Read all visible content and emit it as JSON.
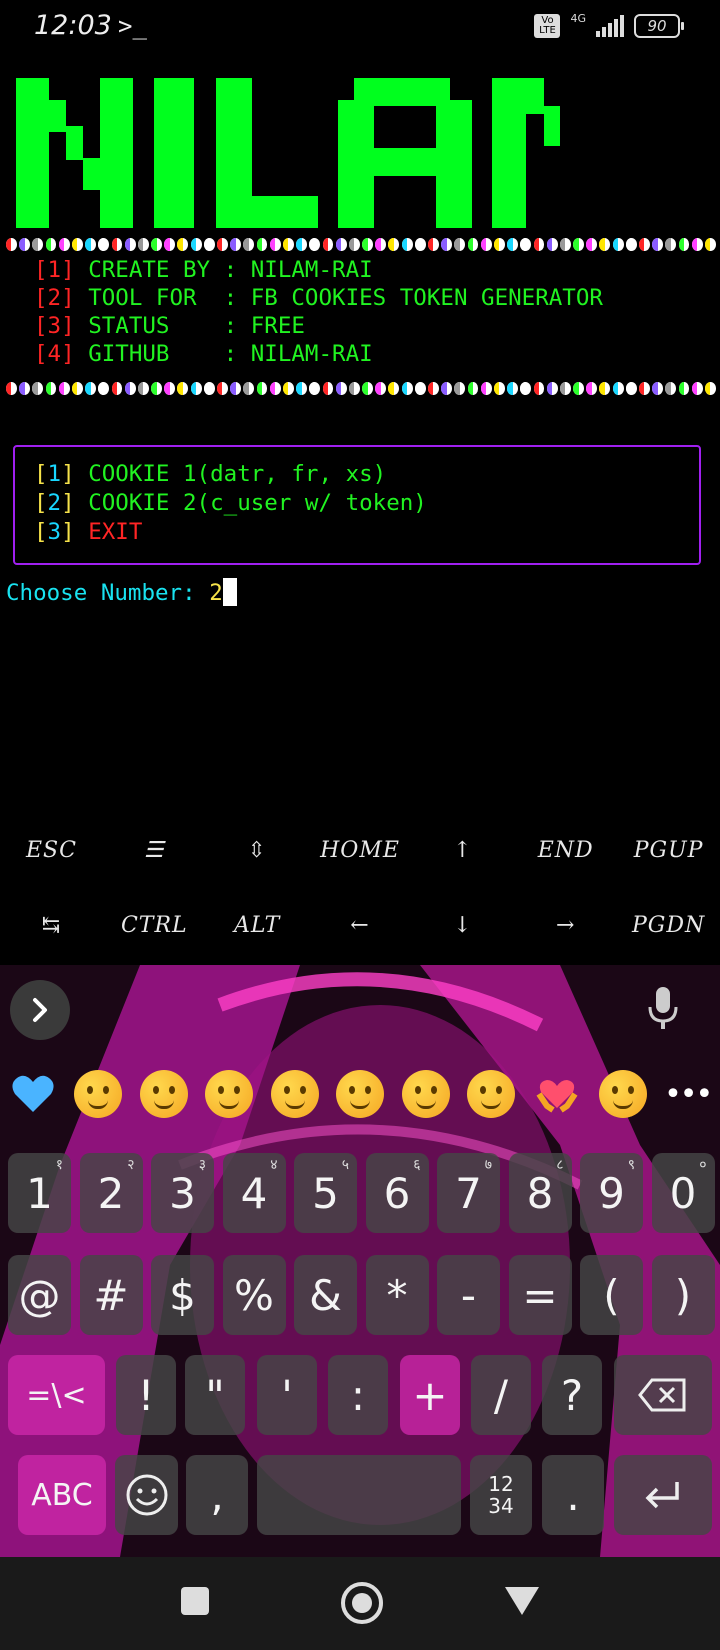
{
  "status_bar": {
    "time": "12:03",
    "prompt_icon": "terminal-prompt-icon",
    "volte": "Vo LTE",
    "network": "4G",
    "battery": "90"
  },
  "banner": {
    "logo_text": "NILAM",
    "logo_color": "#00ff1e",
    "info": [
      {
        "num": "1",
        "label": "CREATE BY ",
        "value": "NILAM-RAI"
      },
      {
        "num": "2",
        "label": "TOOL FOR  ",
        "value": "FB COOKIES TOKEN GENERATOR"
      },
      {
        "num": "3",
        "label": "STATUS    ",
        "value": "FREE"
      },
      {
        "num": "4",
        "label": "GITHUB    ",
        "value": "NILAM-RAI"
      }
    ]
  },
  "menu": {
    "options": [
      {
        "num": "1",
        "label": "COOKIE 1(datr, fr, xs)"
      },
      {
        "num": "2",
        "label": "COOKIE 2(c_user w/ token)"
      },
      {
        "num": "3",
        "label": "EXIT"
      }
    ],
    "prompt": "Choose Number: ",
    "input_value": "2"
  },
  "extra_keys": {
    "row1": [
      "ESC",
      "☰",
      "⇳",
      "HOME",
      "↑",
      "END",
      "PGUP"
    ],
    "row2": [
      "↹",
      "CTRL",
      "ALT",
      "←",
      "↓",
      "→",
      "PGDN"
    ]
  },
  "keyboard": {
    "emoji_row": [
      "blue-heart",
      "sneezing-face",
      "tongue-face",
      "relieved-face",
      "eye-roll-face",
      "rofl-face",
      "thinking-face",
      "pensive-face",
      "heart-hands",
      "confused-face"
    ],
    "number_row": [
      {
        "key": "1",
        "alt": "१"
      },
      {
        "key": "2",
        "alt": "२"
      },
      {
        "key": "3",
        "alt": "३"
      },
      {
        "key": "4",
        "alt": "४"
      },
      {
        "key": "5",
        "alt": "५"
      },
      {
        "key": "6",
        "alt": "६"
      },
      {
        "key": "7",
        "alt": "७"
      },
      {
        "key": "8",
        "alt": "८"
      },
      {
        "key": "9",
        "alt": "९"
      },
      {
        "key": "0",
        "alt": "०"
      }
    ],
    "symbol_row1": [
      "@",
      "#",
      "$",
      "%",
      "&",
      "*",
      "-",
      "=",
      "(",
      ")"
    ],
    "symbol_row2": [
      "=\\<",
      "!",
      "\"",
      "'",
      ":",
      "+",
      "/",
      "?"
    ],
    "bottom": {
      "abc": "ABC",
      "comma": ",",
      "numpad": "12\n34",
      "period": "."
    }
  }
}
